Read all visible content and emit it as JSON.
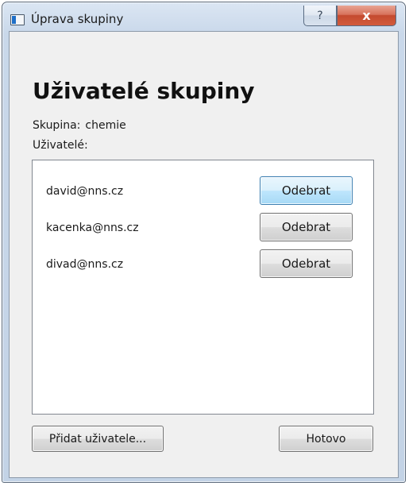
{
  "window": {
    "title": "Úprava skupiny",
    "help_label": "?",
    "close_label": "x"
  },
  "main": {
    "heading": "Uživatelé skupiny",
    "group_label": "Skupina:",
    "group_value": "chemie",
    "users_label": "Uživatelé:"
  },
  "users": [
    {
      "email": "david@nns.cz",
      "remove_label": "Odebrat"
    },
    {
      "email": "kacenka@nns.cz",
      "remove_label": "Odebrat"
    },
    {
      "email": "divad@nns.cz",
      "remove_label": "Odebrat"
    }
  ],
  "footer": {
    "add_label": "Přidat uživatele...",
    "done_label": "Hotovo"
  },
  "colors": {
    "focus_button": "#bee6fd",
    "close_button": "#c44a2f"
  }
}
